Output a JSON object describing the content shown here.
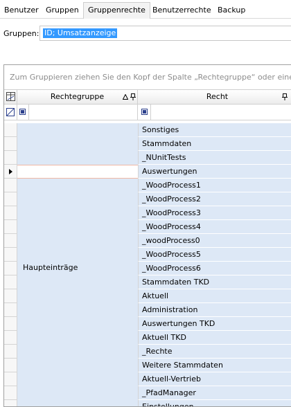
{
  "tabs": [
    {
      "label": "Benutzer",
      "active": false
    },
    {
      "label": "Gruppen",
      "active": false
    },
    {
      "label": "Gruppenrechte",
      "active": true
    },
    {
      "label": "Benutzerrechte",
      "active": false
    },
    {
      "label": "Backup",
      "active": false
    }
  ],
  "group_selector": {
    "label": "Gruppen:",
    "value": "ID; Umsatzanzeige"
  },
  "grid": {
    "group_panel_hint": "Zum Gruppieren ziehen Sie den Kopf der Spalte „Rechtegruppe“ oder eine",
    "columns": [
      {
        "label": "Rechtegruppe",
        "sort": "ascending",
        "pinned": true
      },
      {
        "label": "Recht",
        "pinned": true
      }
    ],
    "group_value": "Haupteinträge",
    "current_row_index": 3,
    "rows": [
      "Sonstiges",
      "Stammdaten",
      "_NUnitTests",
      "Auswertungen",
      "_WoodProcess1",
      "_WoodProcess2",
      "_WoodProcess3",
      "_WoodProcess4",
      "_woodProcess0",
      "_WoodProcess5",
      "_WoodProcess6",
      "Stammdaten TKD",
      "Aktuell",
      "Administration",
      "Auswertungen TKD",
      "Aktuell TKD",
      "_Rechte",
      "Weitere Stammdaten",
      "Aktuell-Vertrieb",
      "_PfadManager",
      "Einstellungen"
    ]
  },
  "colors": {
    "selection": "#3399ff",
    "row_highlight": "#dde8f6",
    "current_row_border": "#f0b7a4"
  }
}
